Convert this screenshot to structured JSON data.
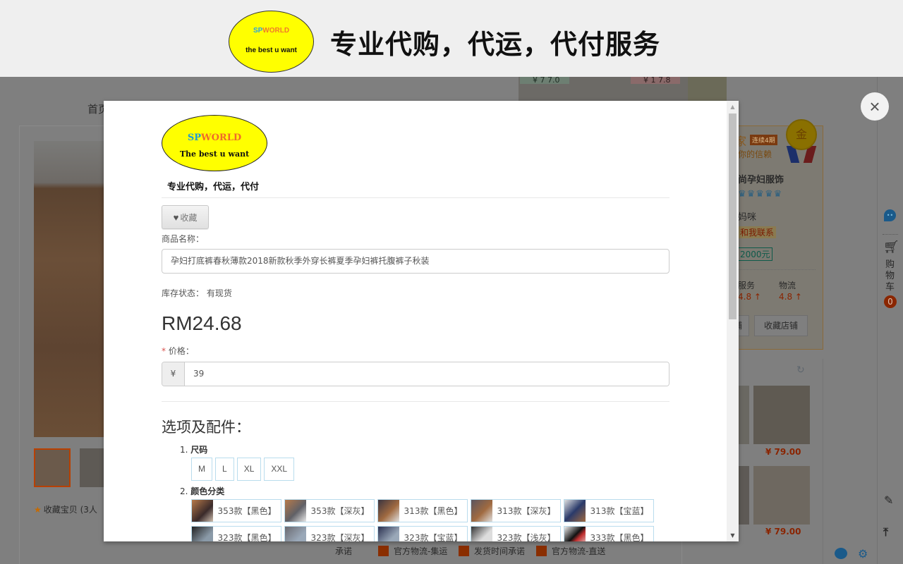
{
  "banner": {
    "logo_brand_sp": "SP",
    "logo_brand_world": "WORLD",
    "logo_tagline": "the best u want",
    "title": "专业代购，代运，代付服务"
  },
  "background_page": {
    "nav_home": "首页",
    "favorite_item": "收藏宝贝 (3人",
    "ad_price_1": "¥ 7 7.0",
    "ad_price_2": "¥ 1 7.8",
    "shop": {
      "header_char": "家",
      "badge": "连续4期",
      "trust": "你的信赖",
      "name": "尚孕妇服饰",
      "crowns": "♛♛♛♛♛",
      "owner": "妈咪",
      "contact": "和我联系",
      "deposit": "2000元",
      "scores": [
        {
          "label": "服务",
          "value": "4.8 ↑"
        },
        {
          "label": "物流",
          "value": "4.8 ↑"
        }
      ],
      "buttons": [
        "铺",
        "收藏店铺"
      ],
      "medal_char": "金"
    },
    "recommendations": [
      {
        "price": "¥ 79.00"
      },
      {
        "price": "¥ 79.00"
      }
    ],
    "footer": {
      "promise": "承诺",
      "items": [
        "官方物流-集运",
        "发货时间承诺",
        "官方物流-直送"
      ]
    }
  },
  "right_rail": {
    "cart_label": "购物车",
    "cart_count": "0"
  },
  "modal": {
    "logo_brand_sp": "SP",
    "logo_brand_world": "WORLD",
    "logo_tagline": "The best u want",
    "slogan": "专业代购，代运，代付",
    "favorite_button": "收藏",
    "product_name_label": "商品名称：",
    "product_name_value": "孕妇打底裤春秋薄款2018新款秋季外穿长裤夏季孕妇裤托腹裤子秋装",
    "stock_label": "库存状态：",
    "stock_value": "有现货",
    "price_display": "RM24.68",
    "price_label_required": "*",
    "price_label": "价格：",
    "price_currency": "¥",
    "price_value": "39",
    "options_title": "选项及配件：",
    "option_groups": [
      {
        "index": "1.",
        "name": "尺码",
        "values": [
          "M",
          "L",
          "XL",
          "XXL"
        ]
      },
      {
        "index": "2.",
        "name": "颜色分类",
        "values": [
          "353款【黑色】",
          "353款【深灰】",
          "313款【黑色】",
          "313款【深灰】",
          "313款【宝蓝】",
          "323款【黑色】",
          "323款【深灰】",
          "323款【宝蓝】",
          "323款【浅灰】",
          "333款【黑色】"
        ]
      }
    ]
  },
  "close_button_label": "×"
}
